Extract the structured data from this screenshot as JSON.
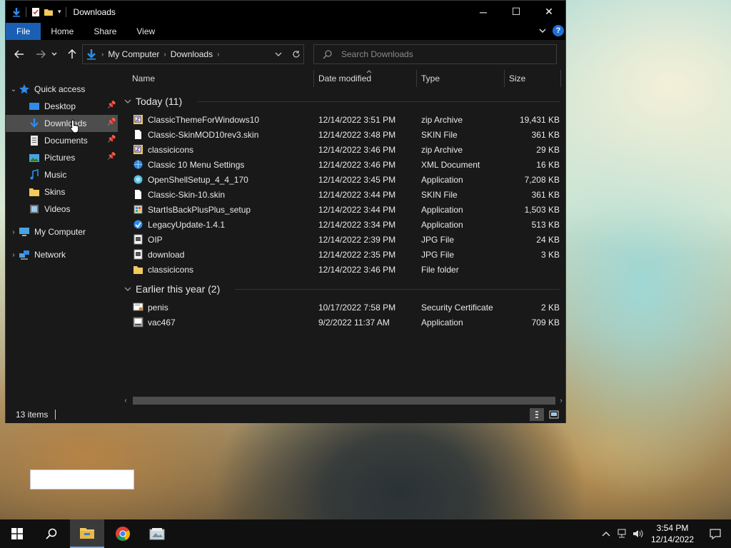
{
  "window": {
    "title": "Downloads",
    "controls": {
      "minimize": "─",
      "maximize": "☐",
      "close": "✕"
    }
  },
  "ribbon": {
    "tabs": [
      "File",
      "Home",
      "Share",
      "View"
    ],
    "help": "?"
  },
  "address": {
    "crumbs": [
      "My Computer",
      "Downloads"
    ]
  },
  "search": {
    "placeholder": "Search Downloads"
  },
  "navpane": {
    "quick_access": "Quick access",
    "items": [
      {
        "label": "Desktop",
        "icon": "desktop-icon",
        "pinned": true
      },
      {
        "label": "Downloads",
        "icon": "downloads-icon",
        "pinned": true,
        "selected": true
      },
      {
        "label": "Documents",
        "icon": "documents-icon",
        "pinned": true
      },
      {
        "label": "Pictures",
        "icon": "pictures-icon",
        "pinned": true
      },
      {
        "label": "Music",
        "icon": "music-icon"
      },
      {
        "label": "Skins",
        "icon": "folder-icon"
      },
      {
        "label": "Videos",
        "icon": "videos-icon"
      }
    ],
    "my_computer": "My Computer",
    "network": "Network"
  },
  "columns": {
    "name": "Name",
    "date": "Date modified",
    "type": "Type",
    "size": "Size"
  },
  "groups": [
    {
      "title": "Today (11)",
      "files": [
        {
          "name": "ClassicThemeForWindows10",
          "date": "12/14/2022 3:51 PM",
          "type": "zip Archive",
          "size": "19,431 KB",
          "icon": "zip-icon"
        },
        {
          "name": "Classic-SkinMOD10rev3.skin",
          "date": "12/14/2022 3:48 PM",
          "type": "SKIN File",
          "size": "361 KB",
          "icon": "file-icon"
        },
        {
          "name": "classicicons",
          "date": "12/14/2022 3:46 PM",
          "type": "zip Archive",
          "size": "29 KB",
          "icon": "zip-icon"
        },
        {
          "name": "Classic 10 Menu Settings",
          "date": "12/14/2022 3:46 PM",
          "type": "XML Document",
          "size": "16 KB",
          "icon": "xml-icon"
        },
        {
          "name": "OpenShellSetup_4_4_170",
          "date": "12/14/2022 3:45 PM",
          "type": "Application",
          "size": "7,208 KB",
          "icon": "shell-app-icon"
        },
        {
          "name": "Classic-Skin-10.skin",
          "date": "12/14/2022 3:44 PM",
          "type": "SKIN File",
          "size": "361 KB",
          "icon": "file-icon"
        },
        {
          "name": "StartIsBackPlusPlus_setup",
          "date": "12/14/2022 3:44 PM",
          "type": "Application",
          "size": "1,503 KB",
          "icon": "installer-icon"
        },
        {
          "name": "LegacyUpdate-1.4.1",
          "date": "12/14/2022 3:34 PM",
          "type": "Application",
          "size": "513 KB",
          "icon": "update-app-icon"
        },
        {
          "name": "OIP",
          "date": "12/14/2022 2:39 PM",
          "type": "JPG File",
          "size": "24 KB",
          "icon": "image-icon"
        },
        {
          "name": "download",
          "date": "12/14/2022 2:35 PM",
          "type": "JPG File",
          "size": "3 KB",
          "icon": "image-icon"
        },
        {
          "name": "classicicons",
          "date": "12/14/2022 3:46 PM",
          "type": "File folder",
          "size": "",
          "icon": "folder-icon"
        }
      ]
    },
    {
      "title": "Earlier this year (2)",
      "files": [
        {
          "name": "penis",
          "date": "10/17/2022 7:58 PM",
          "type": "Security Certificate",
          "size": "2 KB",
          "icon": "certificate-icon"
        },
        {
          "name": "vac467",
          "date": "9/2/2022 11:37 AM",
          "type": "Application",
          "size": "709 KB",
          "icon": "app-icon"
        }
      ]
    }
  ],
  "status": {
    "count": "13 items"
  },
  "taskbar": {
    "time": "3:54 PM",
    "date": "12/14/2022"
  },
  "colors": {
    "file_tab": "#1a5fb4",
    "selected": "#4d4d4d",
    "window_bg": "#191919"
  }
}
